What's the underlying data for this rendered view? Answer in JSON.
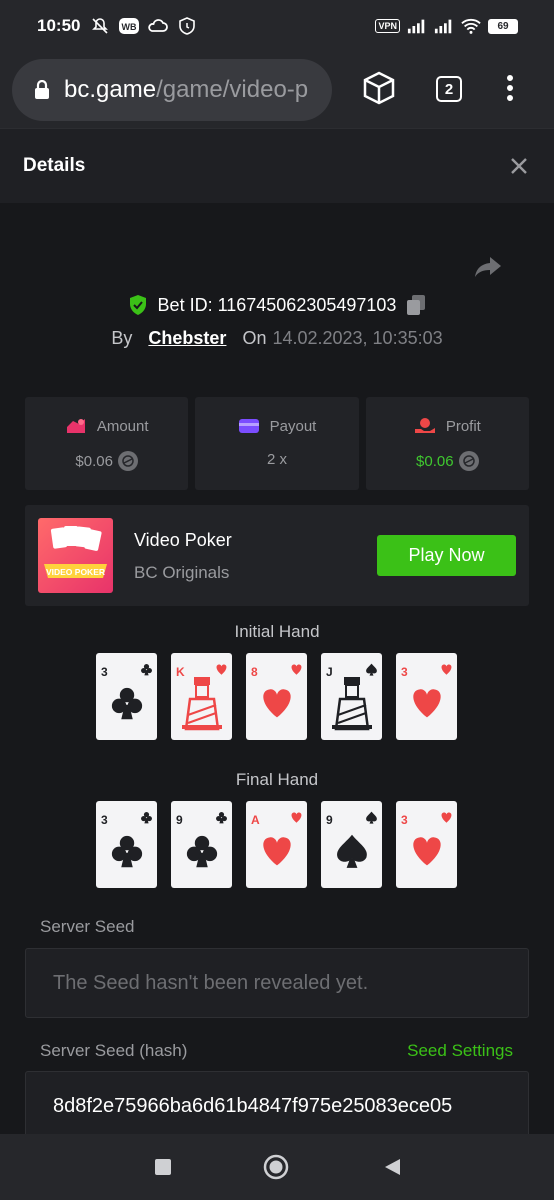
{
  "status_bar": {
    "time": "10:50",
    "vpn": "VPN",
    "battery": "69",
    "icons": [
      "mute-icon",
      "wb-icon",
      "cloud-sync-icon",
      "shield-icon",
      "signal-icon",
      "signal-icon",
      "wifi-icon",
      "battery-icon"
    ]
  },
  "browser": {
    "domain": "bc.game",
    "path": "/game/video-p",
    "tab_count": "2"
  },
  "details": {
    "title": "Details"
  },
  "bet": {
    "id_text": "Bet ID: 116745062305497103",
    "by_label": "By",
    "user": "Chebster",
    "on_label": "On",
    "date": "14.02.2023, 10:35:03"
  },
  "stats": [
    {
      "label": "Amount",
      "value": "$0.06",
      "icon": "amount-icon"
    },
    {
      "label": "Payout",
      "value": "2 x",
      "icon": "payout-icon"
    },
    {
      "label": "Profit",
      "value": "$0.06",
      "icon": "profit-icon"
    }
  ],
  "game": {
    "name": "Video Poker",
    "provider": "BC Originals",
    "play_label": "Play Now",
    "thumb_text": "VIDEO POKER"
  },
  "initial_hand": {
    "label": "Initial Hand",
    "cards": [
      {
        "rank": "3",
        "suit": "clubs"
      },
      {
        "rank": "K",
        "suit": "hearts"
      },
      {
        "rank": "8",
        "suit": "hearts"
      },
      {
        "rank": "J",
        "suit": "spades"
      },
      {
        "rank": "3",
        "suit": "hearts"
      }
    ]
  },
  "final_hand": {
    "label": "Final Hand",
    "cards": [
      {
        "rank": "3",
        "suit": "clubs"
      },
      {
        "rank": "9",
        "suit": "clubs"
      },
      {
        "rank": "A",
        "suit": "hearts"
      },
      {
        "rank": "9",
        "suit": "spades"
      },
      {
        "rank": "3",
        "suit": "hearts"
      }
    ]
  },
  "server_seed": {
    "label": "Server Seed",
    "value": "The Seed hasn't been revealed yet."
  },
  "server_seed_hash": {
    "label": "Server Seed (hash)",
    "settings_label": "Seed Settings",
    "value": "8d8f2e75966ba6d61b4847f975e25083ece05"
  },
  "colors": {
    "accent_green": "#3bc117",
    "heart_red": "#ee4747",
    "dark_suit": "#1f2024"
  }
}
